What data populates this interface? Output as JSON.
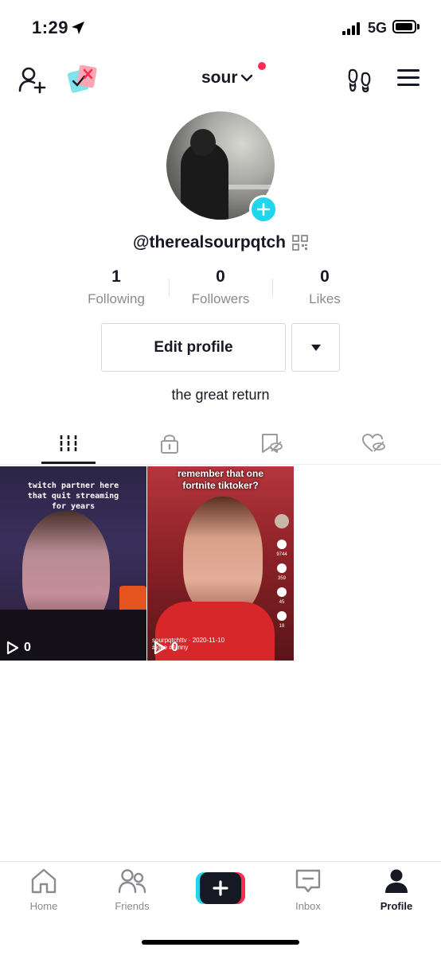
{
  "status_bar": {
    "time": "1:29",
    "network": "5G",
    "icons": [
      "location-arrow-icon",
      "signal-icon",
      "battery-icon"
    ]
  },
  "top_nav": {
    "username": "sour",
    "icons": [
      "add-friend-icon",
      "sticker-icon",
      "chevron-down-icon",
      "footprint-icon",
      "menu-icon"
    ],
    "notification_dot_color": "#fe2c55"
  },
  "profile": {
    "handle": "@therealsourpqtch",
    "stats": [
      {
        "value": "1",
        "label": "Following"
      },
      {
        "value": "0",
        "label": "Followers"
      },
      {
        "value": "0",
        "label": "Likes"
      }
    ],
    "edit_label": "Edit profile",
    "bio": "the great return"
  },
  "tabs": [
    {
      "name": "videos",
      "icon": "grid-icon",
      "active": true
    },
    {
      "name": "private",
      "icon": "lock-icon",
      "active": false
    },
    {
      "name": "favorites",
      "icon": "bookmark-hidden-icon",
      "active": false
    },
    {
      "name": "liked",
      "icon": "heart-hidden-icon",
      "active": false
    }
  ],
  "videos": [
    {
      "caption": [
        "twitch partner here",
        "that quit streaming",
        "for years"
      ],
      "views": "0"
    },
    {
      "caption": [
        "remember that one",
        "fortnite tiktoker?"
      ],
      "views": "0",
      "side_counts": [
        "9744",
        "359",
        "45",
        "18"
      ],
      "author": "sourpqtchttv",
      "date": "· 2020-11-10",
      "tags": "#joke #funny"
    }
  ],
  "bottom_nav": [
    {
      "label": "Home",
      "icon": "home-icon"
    },
    {
      "label": "Friends",
      "icon": "friends-icon"
    },
    {
      "label": "",
      "icon": "create-plus-icon"
    },
    {
      "label": "Inbox",
      "icon": "inbox-icon"
    },
    {
      "label": "Profile",
      "icon": "profile-icon",
      "active": true
    }
  ],
  "colors": {
    "accent": "#fe2c55",
    "cyan": "#20d5ec",
    "text": "#161823",
    "muted": "#8a8b91"
  }
}
